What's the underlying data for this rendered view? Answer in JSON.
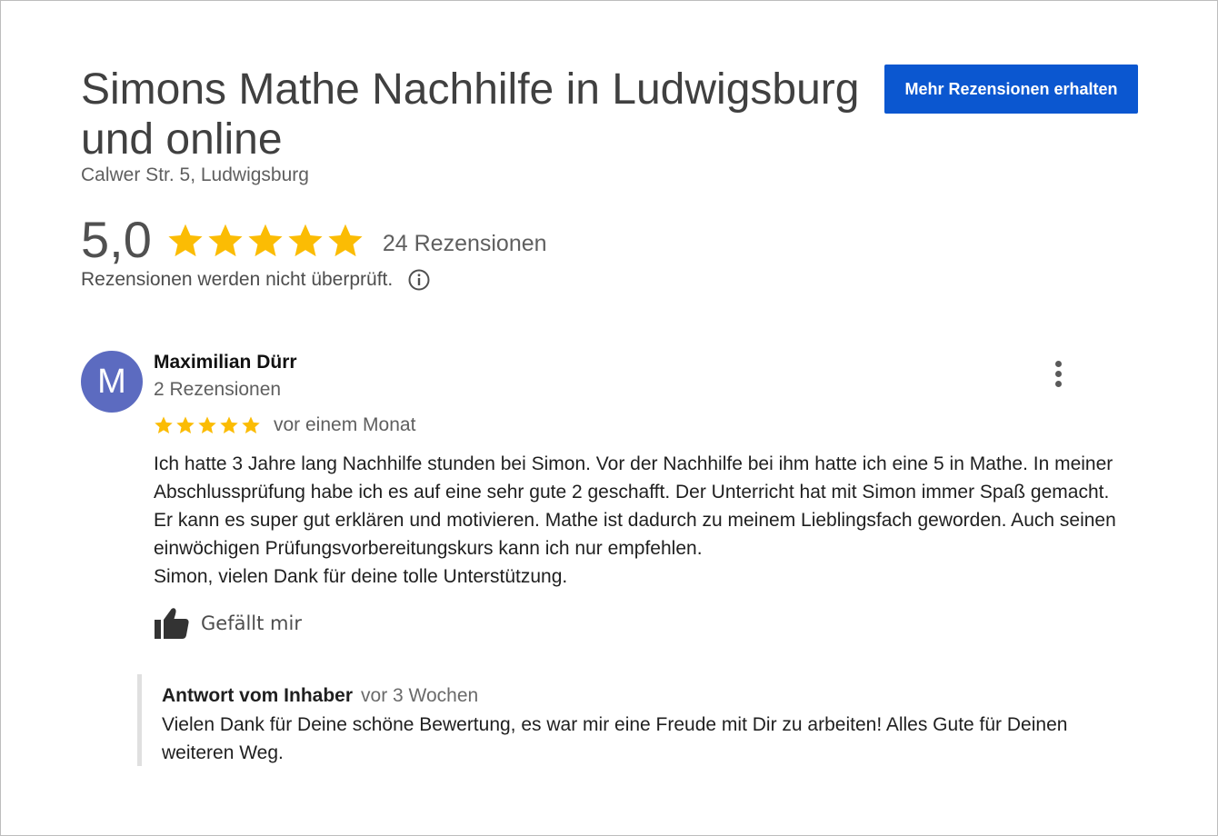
{
  "business": {
    "title": "Simons Mathe Nachhilfe in Ludwigsburg und online",
    "address": "Calwer Str. 5, Ludwigsburg",
    "cta_label": "Mehr Rezensionen erhalten"
  },
  "rating": {
    "score": "5,0",
    "stars": 5,
    "review_count_label": "24 Rezensionen",
    "notice": "Rezensionen werden nicht überprüft.",
    "info_icon": "info-circle-icon"
  },
  "review": {
    "avatar_letter": "M",
    "avatar_color": "#5c6bc0",
    "author": "Maximilian Dürr",
    "author_review_count": "2 Rezensionen",
    "stars": 5,
    "date": "vor einem Monat",
    "text_lines": [
      "Ich hatte 3 Jahre lang Nachhilfe stunden bei Simon. Vor der Nachhilfe bei ihm hatte ich eine 5 in Mathe. In meiner Abschlussprüfung habe ich es auf eine sehr gute 2 geschafft. Der Unterricht hat mit Simon immer Spaß gemacht. Er kann es super gut erklären und motivieren. Mathe ist dadurch zu meinem Lieblingsfach geworden. Auch seinen einwöchigen Prüfungsvorbereitungskurs kann ich nur empfehlen.",
      "Simon, vielen Dank für deine tolle Unterstützung."
    ],
    "like_label": "Gefällt mir",
    "like_icon": "thumbs-up-icon",
    "more_icon": "more-vertical-icon"
  },
  "owner_reply": {
    "title": "Antwort vom Inhaber",
    "date": "vor 3 Wochen",
    "text": "Vielen Dank für Deine schöne Bewertung, es war mir eine Freude mit Dir zu arbeiten! Alles Gute für Deinen weiteren Weg."
  },
  "colors": {
    "accent": "#0b57d0",
    "star": "#fbbc04",
    "text_primary": "#1f1f1f",
    "text_secondary": "#5f5f5f"
  }
}
